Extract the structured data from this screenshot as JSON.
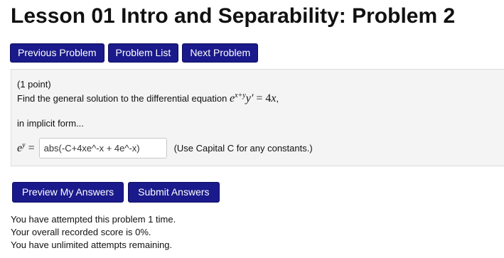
{
  "page": {
    "title": "Lesson 01 Intro and Separability: Problem 2"
  },
  "nav": {
    "previous_label": "Previous Problem",
    "list_label": "Problem List",
    "next_label": "Next Problem"
  },
  "problem": {
    "points": "(1 point)",
    "prompt_text": "Find the general solution to the differential equation",
    "equation": {
      "base": "e",
      "exponent": "x+y",
      "y_prime": "y′",
      "equals": "=",
      "rhs_coeff": "4",
      "rhs_var": "x",
      "trailing": ","
    },
    "implicit_text": "in implicit form...",
    "answer": {
      "lhs_base": "e",
      "lhs_exponent": "y",
      "lhs_equals": "=",
      "value": "abs(-C+4xe^-x + 4e^-x)",
      "hint": "(Use Capital C for any constants.)"
    }
  },
  "actions": {
    "preview_label": "Preview My Answers",
    "submit_label": "Submit Answers"
  },
  "status": {
    "attempts": "You have attempted this problem 1 time.",
    "score": "Your overall recorded score is 0%.",
    "remaining": "You have unlimited attempts remaining."
  },
  "colors": {
    "button_bg": "#1a1a8c",
    "problem_bg": "#f4f4f4"
  }
}
